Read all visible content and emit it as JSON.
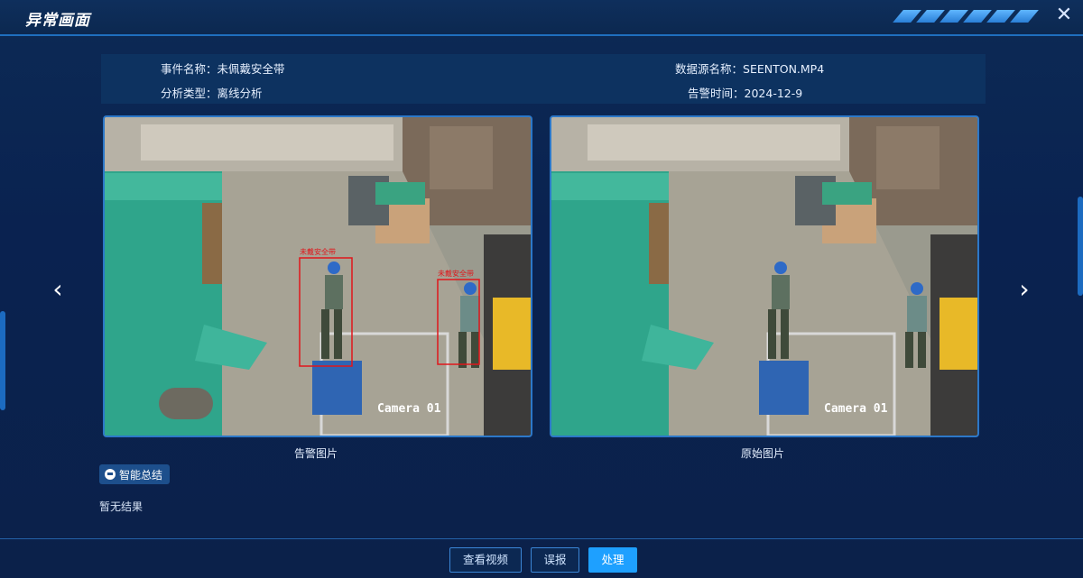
{
  "dialog": {
    "title": "异常画面"
  },
  "info": {
    "event_name_label": "事件名称：",
    "event_name_value": "未佩戴安全带",
    "analysis_type_label": "分析类型：",
    "analysis_type_value": "离线分析",
    "source_name_label": "数据源名称：",
    "source_name_value": "SEENTON.MP4",
    "alarm_time_label": "告警时间：",
    "alarm_time_value": "2024-12-9"
  },
  "images": {
    "alarm": {
      "caption": "告警图片",
      "camera_label": "Camera 01",
      "detections": [
        {
          "label": "未戴安全带"
        },
        {
          "label": "未戴安全带"
        }
      ]
    },
    "original": {
      "caption": "原始图片",
      "camera_label": "Camera 01"
    }
  },
  "summary": {
    "button_label": "智能总结",
    "result_text": "暂无结果"
  },
  "footer": {
    "view_video_label": "查看视频",
    "false_report_label": "误报",
    "handle_label": "处理"
  },
  "icons": {
    "close": "close-icon",
    "prev": "chevron-left-icon",
    "next": "chevron-right-icon",
    "summary": "chat-bubble-icon"
  },
  "colors": {
    "accent": "#1ea0ff",
    "detection_box": "#e0161b",
    "background": "#0a2250"
  }
}
